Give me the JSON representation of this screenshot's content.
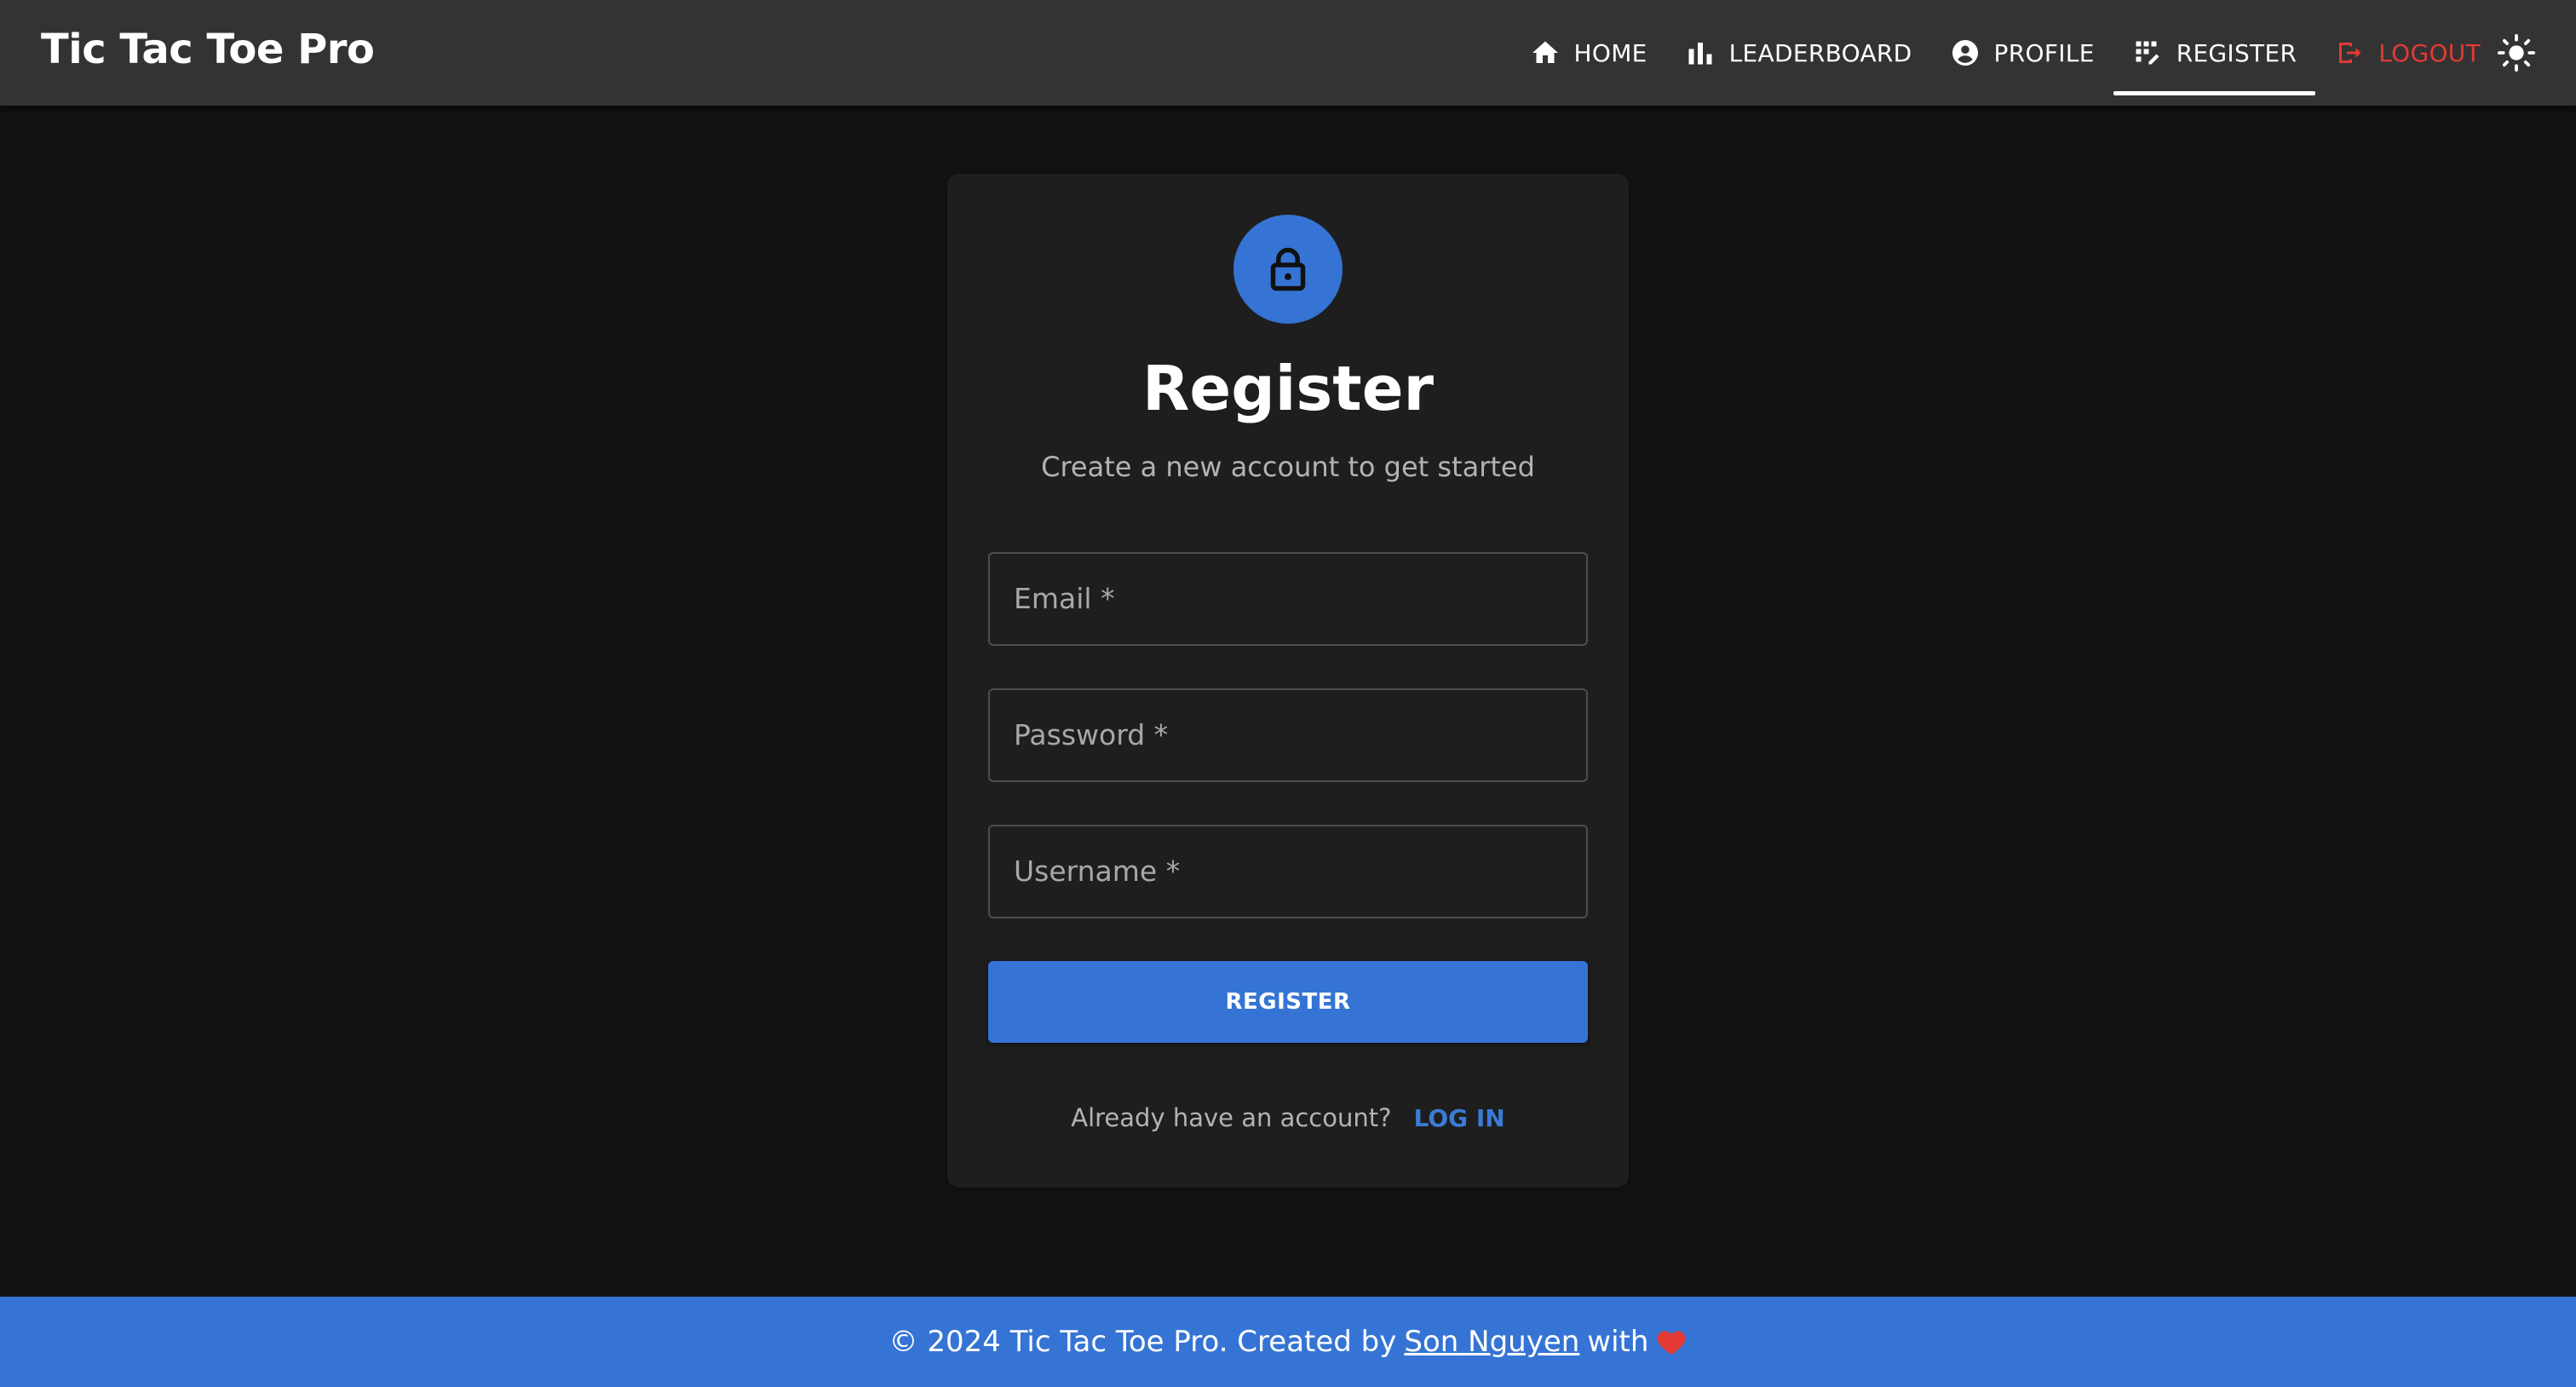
{
  "header": {
    "brand": "Tic Tac Toe Pro",
    "nav": {
      "home": "HOME",
      "leaderboard": "LEADERBOARD",
      "profile": "PROFILE",
      "register": "REGISTER",
      "logout": "LOGOUT"
    },
    "active_item": "register",
    "icons": {
      "home": "home-icon",
      "leaderboard": "bar-chart-icon",
      "profile": "account-circle-icon",
      "register": "app-registration-icon",
      "logout": "logout-icon",
      "theme": "sun-icon"
    }
  },
  "register_card": {
    "icon": "lock-icon",
    "title": "Register",
    "subtitle": "Create a new account to get started",
    "fields": {
      "email": "Email *",
      "password": "Password *",
      "username": "Username *"
    },
    "submit_label": "REGISTER",
    "login_prompt": "Already have an account?",
    "login_link": "LOG IN"
  },
  "footer": {
    "prefix": "© 2024 Tic Tac Toe Pro. Created by",
    "author": "Son Nguyen",
    "suffix": "with"
  },
  "colors": {
    "background": "#121212",
    "appbar": "#333333",
    "card": "#1e1e1e",
    "accent": "#3574d4",
    "logout": "#e53935",
    "muted_text": "#b3b3b3"
  }
}
